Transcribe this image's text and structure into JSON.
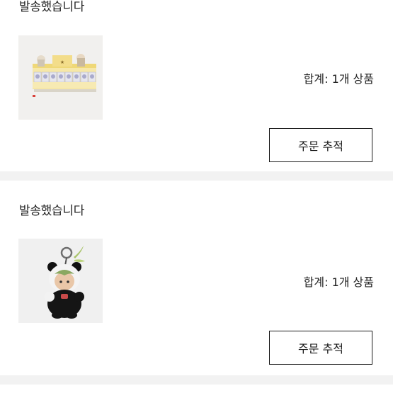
{
  "orders": [
    {
      "status": "발송했습니다",
      "summary": "합계: 1개 상품",
      "track_label": "주문 추적",
      "thumbnail_icon": "figure-box-set-image"
    },
    {
      "status": "발송했습니다",
      "summary": "합계: 1개 상품",
      "track_label": "주문 추적",
      "thumbnail_icon": "panda-keychain-image"
    }
  ]
}
